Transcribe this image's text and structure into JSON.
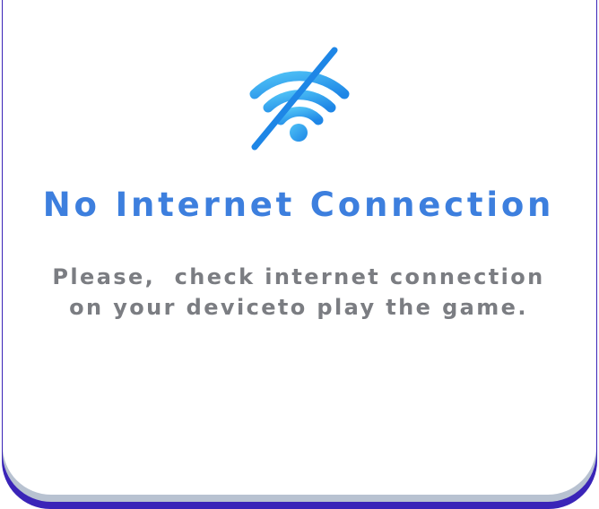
{
  "dialog": {
    "icon": "wifi-off-icon",
    "title": "No Internet Connection",
    "message_lines": [
      "Please,  check internet connection",
      "on your deviceto play the game."
    ]
  },
  "colors": {
    "title": "#3d7fde",
    "message": "#7b7d82",
    "icon_light": "#4fb8f2",
    "icon_dark": "#1e86e6",
    "card_edge": "#3a24b8",
    "card_band": "#b8c2d1"
  }
}
